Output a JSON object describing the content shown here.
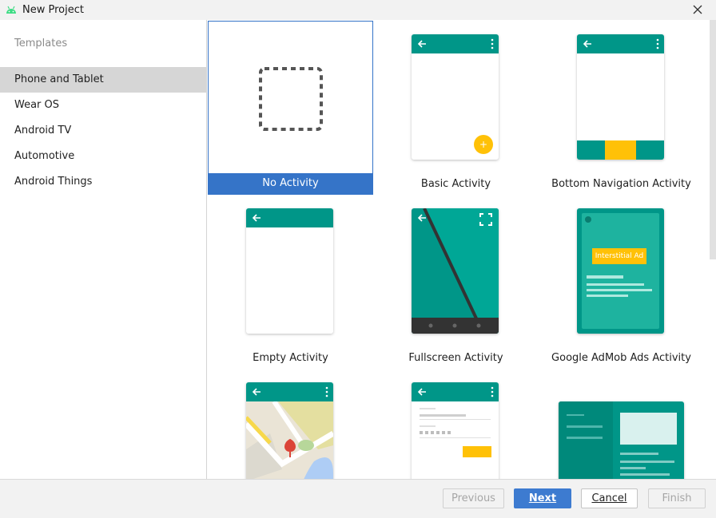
{
  "window": {
    "title": "New Project"
  },
  "sidebar": {
    "heading": "Templates",
    "items": [
      {
        "label": "Phone and Tablet",
        "selected": true
      },
      {
        "label": "Wear OS"
      },
      {
        "label": "Android TV"
      },
      {
        "label": "Automotive"
      },
      {
        "label": "Android Things"
      }
    ]
  },
  "templates": [
    {
      "label": "No Activity",
      "selected": true
    },
    {
      "label": "Basic Activity"
    },
    {
      "label": "Bottom Navigation Activity"
    },
    {
      "label": "Empty Activity"
    },
    {
      "label": "Fullscreen Activity"
    },
    {
      "label": "Google AdMob Ads Activity",
      "ad_text": "Interstitial Ad"
    },
    {
      "label": ""
    },
    {
      "label": ""
    },
    {
      "label": ""
    }
  ],
  "footer": {
    "previous": "Previous",
    "next": "Next",
    "cancel": "Cancel",
    "finish": "Finish"
  },
  "colors": {
    "teal": "#009688",
    "accent_yellow": "#FFC107",
    "selection_blue": "#3574c8"
  }
}
